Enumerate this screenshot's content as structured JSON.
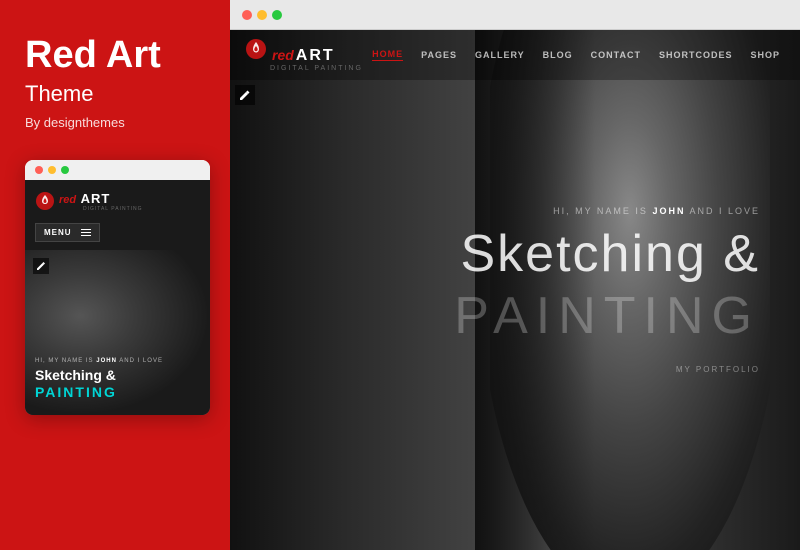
{
  "theme": {
    "title": "Red Art",
    "subtitle": "Theme",
    "author": "By designthemes",
    "accent_color": "#cc1414",
    "bg_color": "#cc1414"
  },
  "mobile_preview": {
    "titlebar_dots": [
      "red",
      "yellow",
      "green"
    ],
    "logo_red": "red",
    "logo_text_italic": "ART",
    "logo_tagline": "DIGITAL PAINTING",
    "menu_label": "MENU",
    "intro_text": "HI, MY NAME IS",
    "intro_name": "JOHN",
    "intro_and": "AND I LOVE",
    "sketching_text": "Sketching &",
    "painting_text": "PAINTING"
  },
  "desktop_preview": {
    "titlebar_dots": [
      "red",
      "yellow",
      "green"
    ],
    "logo_red_text": "red",
    "logo_art_text": "ART",
    "logo_tagline": "DIGITAL PAINTING",
    "nav_links": [
      {
        "label": "HOME",
        "active": true
      },
      {
        "label": "PAGES",
        "active": false
      },
      {
        "label": "GALLERY",
        "active": false
      },
      {
        "label": "BLOG",
        "active": false
      },
      {
        "label": "CONTACT",
        "active": false
      },
      {
        "label": "SHORTCODES",
        "active": false
      },
      {
        "label": "SHOP",
        "active": false
      }
    ],
    "intro_text": "HI, MY NAME IS",
    "intro_name": "JOHN",
    "intro_and": "AND I LOVE",
    "sketching_text": "Sketching &",
    "painting_text": "PAINTING",
    "portfolio_link": "MY PORTFOLIO"
  }
}
